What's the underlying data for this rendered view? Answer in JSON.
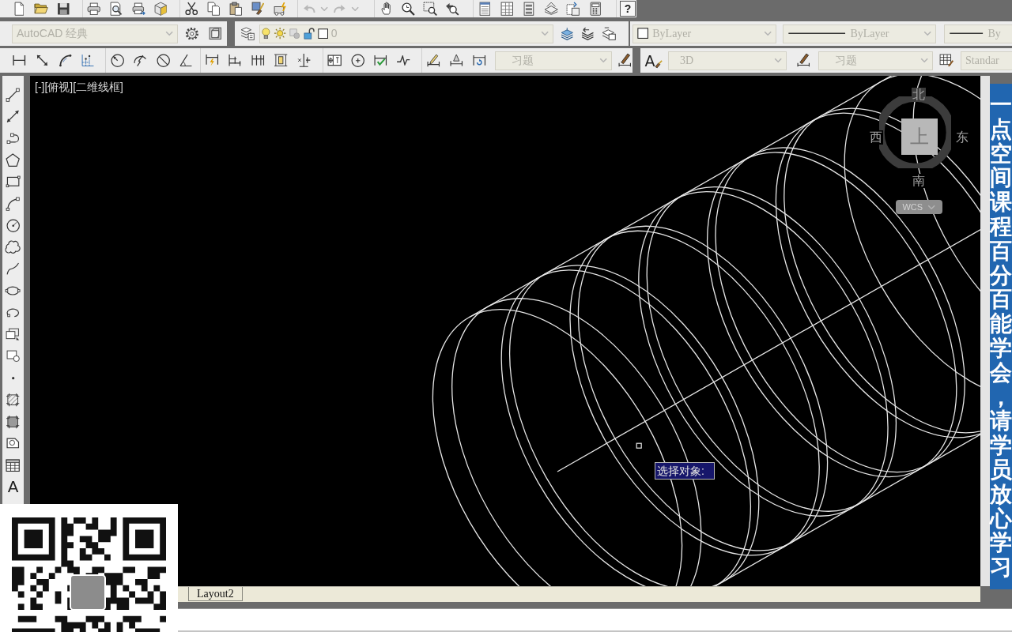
{
  "standard_toolbar": {
    "help_button": "?"
  },
  "workspaces_toolbar": {
    "workspace": {
      "value": "AutoCAD 经典",
      "disabled": true
    }
  },
  "layers_toolbar": {
    "layer": {
      "value": "0",
      "disabled": true
    }
  },
  "properties_toolbar": {
    "color": {
      "value": "ByLayer",
      "disabled": true
    },
    "linetype": {
      "value": "ByLayer",
      "disabled": true
    },
    "lineweight": {
      "value": "By",
      "disabled": true
    }
  },
  "dimension_toolbar": {
    "dim_style": {
      "value": "习题",
      "disabled": true
    }
  },
  "styles_toolbar": {
    "text_style_button": "A",
    "text_style": {
      "value": "3D",
      "disabled": true
    },
    "dim_style": {
      "value": "习题",
      "disabled": true
    },
    "table_style": {
      "value": "Standar",
      "disabled": true
    }
  },
  "draw_toolbar": {
    "text_button": "A"
  },
  "viewport": {
    "controls_label": "[-][俯视][二维线框]",
    "viewcube": {
      "north": "北",
      "west": "西",
      "east": "东",
      "south": "南",
      "face": "上",
      "ucs_menu": "WCS"
    },
    "tooltip": "选择对象:"
  },
  "layout_tabs": [
    {
      "label": "Layout2",
      "selected": false
    }
  ],
  "banner": {
    "text": "一点空间课程百分百能学会，请学员放心学习"
  }
}
